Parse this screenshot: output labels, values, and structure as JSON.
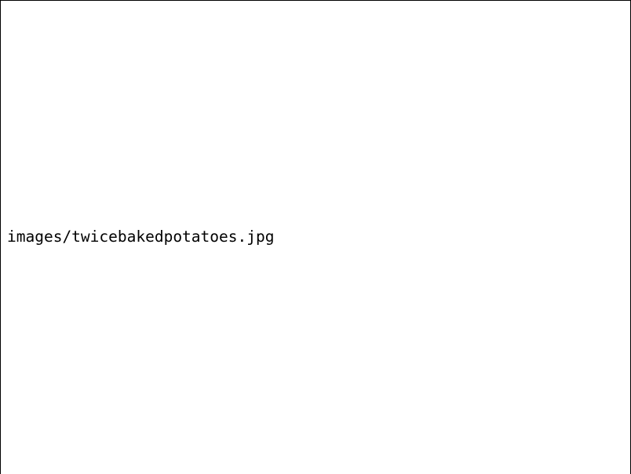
{
  "image_placeholder": {
    "path_text": "images/twicebakedpotatoes.jpg"
  },
  "colors": {
    "background": "#ffffff",
    "border": "#000000",
    "text": "#000000"
  }
}
